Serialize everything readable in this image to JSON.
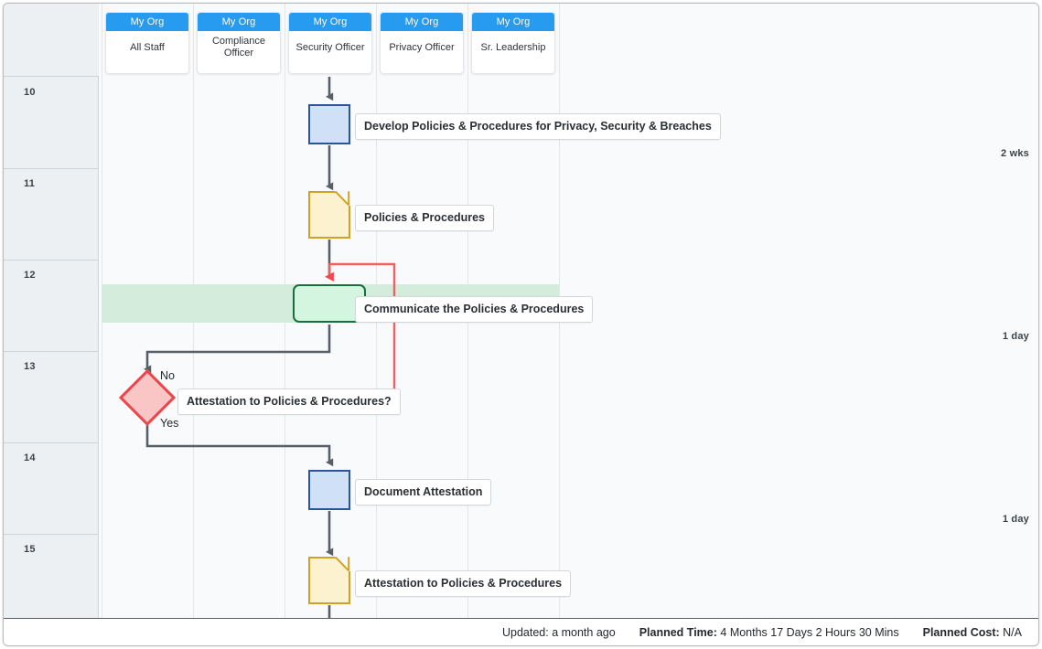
{
  "lanes": [
    {
      "badge": "My Org",
      "name": "All Staff"
    },
    {
      "badge": "My Org",
      "name": "Compliance Officer"
    },
    {
      "badge": "My Org",
      "name": "Security Officer"
    },
    {
      "badge": "My Org",
      "name": "Privacy Officer"
    },
    {
      "badge": "My Org",
      "name": "Sr. Leadership"
    }
  ],
  "timeline": {
    "rows": [
      {
        "num": "10",
        "duration": "2 wks"
      },
      {
        "num": "11",
        "duration": ""
      },
      {
        "num": "12",
        "duration": "1 day"
      },
      {
        "num": "13",
        "duration": ""
      },
      {
        "num": "14",
        "duration": "1 day"
      },
      {
        "num": "15",
        "duration": ""
      }
    ]
  },
  "nodes": [
    {
      "id": "develop-policies",
      "type": "task",
      "label": "Develop Policies & Procedures for Privacy, Security & Breaches"
    },
    {
      "id": "policies-doc",
      "type": "document",
      "label": "Policies & Procedures"
    },
    {
      "id": "communicate",
      "type": "process",
      "label": "Communicate the Policies & Procedures"
    },
    {
      "id": "attestation-q",
      "type": "decision",
      "label": "Attestation to Policies & Procedures?"
    },
    {
      "id": "document-attest",
      "type": "task",
      "label": "Document Attestation"
    },
    {
      "id": "attestation-doc",
      "type": "document",
      "label": "Attestation to Policies & Procedures"
    }
  ],
  "branches": {
    "no": "No",
    "yes": "Yes"
  },
  "footer": {
    "updated_label": "Updated: a month ago",
    "planned_time_label": "Planned Time:",
    "planned_time_value": "4 Months 17 Days 2 Hours 30 Mins",
    "planned_cost_label": "Planned Cost:",
    "planned_cost_value": "N/A"
  },
  "colors": {
    "lane_badge": "#269bf0",
    "task_fill": "#cfe0f7",
    "task_border": "#2a5699",
    "doc_fill": "#fdf2d0",
    "doc_border": "#d1a220",
    "process_fill": "#d4f5e0",
    "process_border": "#17703c",
    "decision_fill": "#f9c5c5",
    "decision_border": "#ea474c",
    "band": "#d3ecdc",
    "connector": "#585f66",
    "loop_connector": "#e8585c"
  }
}
